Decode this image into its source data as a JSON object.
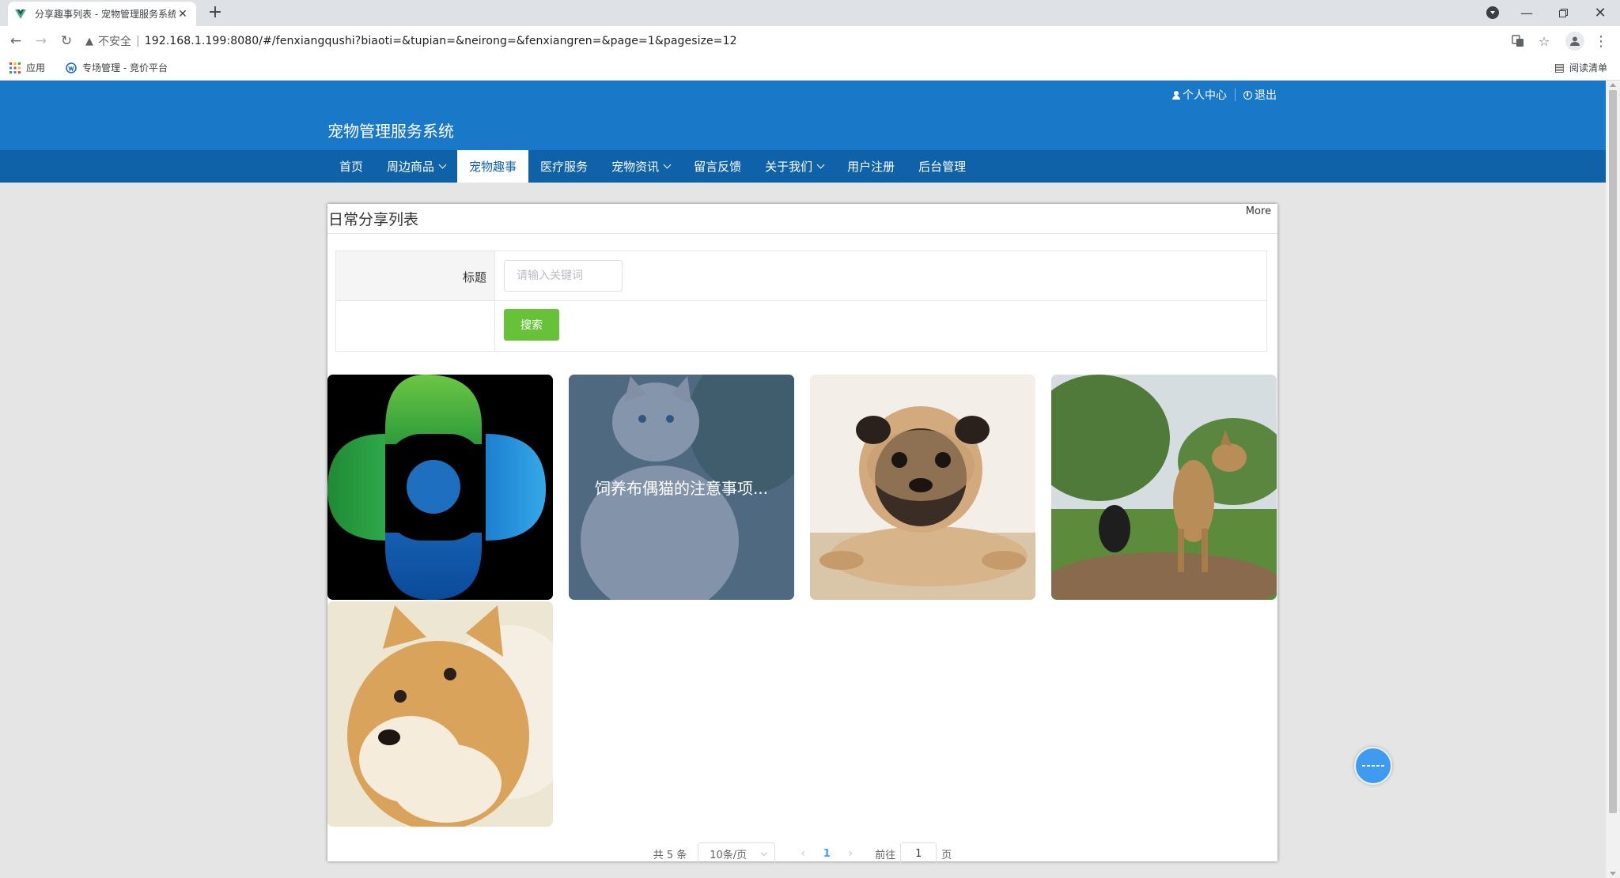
{
  "browser": {
    "tab_title": "分享趣事列表 - 宠物管理服务系统",
    "insecure_label": "不安全",
    "url": "192.168.1.199:8080/#/fenxiangqushi?biaoti=&tupian=&neirong=&fenxiangren=&page=1&pagesize=12",
    "bookmarks": [
      {
        "label": "应用",
        "icon": "apps-grid-icon"
      },
      {
        "label": "专场管理 - 竞价平台",
        "icon": "site-favicon-icon"
      }
    ],
    "reading_list_label": "阅读清单"
  },
  "site": {
    "title": "宠物管理服务系统",
    "personal_center": "个人中心",
    "logout": "退出",
    "nav": [
      {
        "label": "首页",
        "dropdown": false,
        "active": false
      },
      {
        "label": "周边商品",
        "dropdown": true,
        "active": false
      },
      {
        "label": "宠物趣事",
        "dropdown": false,
        "active": true
      },
      {
        "label": "医疗服务",
        "dropdown": false,
        "active": false
      },
      {
        "label": "宠物资讯",
        "dropdown": true,
        "active": false
      },
      {
        "label": "留言反馈",
        "dropdown": false,
        "active": false
      },
      {
        "label": "关于我们",
        "dropdown": true,
        "active": false
      },
      {
        "label": "用户注册",
        "dropdown": false,
        "active": false
      },
      {
        "label": "后台管理",
        "dropdown": false,
        "active": false
      }
    ],
    "colors": {
      "header": "#1978c8",
      "navbar": "#0f62a8",
      "search_button": "#67c23a",
      "pager_active": "#409eff"
    }
  },
  "panel": {
    "title": "日常分享列表",
    "more": "More",
    "search": {
      "label": "标题",
      "placeholder": "请输入关键词",
      "value": "",
      "button": "搜索"
    },
    "cards": [
      {
        "image": "logo-clover-image",
        "overlay_text": ""
      },
      {
        "image": "white-cat-image",
        "overlay_text": "饲养布偶猫的注意事项..."
      },
      {
        "image": "pug-dog-image",
        "overlay_text": ""
      },
      {
        "image": "dogs-outdoor-image",
        "overlay_text": ""
      },
      {
        "image": "shiba-dog-image",
        "overlay_text": ""
      }
    ],
    "pagination": {
      "total": "共 5 条",
      "page_size": "10条/页",
      "current_page": "1",
      "goto_label": "前往",
      "goto_value": "1",
      "page_unit": "页"
    }
  }
}
